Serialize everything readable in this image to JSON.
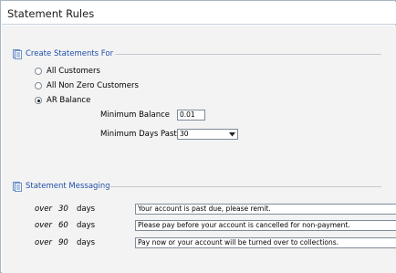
{
  "header": {
    "title": "Statement Rules"
  },
  "create_section": {
    "title": "Create Statements For",
    "icon": "document-icon",
    "options": [
      {
        "label": "All Customers",
        "selected": false
      },
      {
        "label": "All Non Zero Customers",
        "selected": false
      },
      {
        "label": "AR Balance",
        "selected": true
      }
    ],
    "minimum_balance": {
      "label": "Minimum Balance",
      "value": "0.01"
    },
    "minimum_days_past": {
      "label": "Minimum Days Past",
      "value": "30"
    }
  },
  "messaging_section": {
    "title": "Statement Messaging",
    "icon": "document-icon",
    "rows": [
      {
        "over": "over",
        "days_number": "30",
        "days_label": "days",
        "message": "Your account is past due, please remit."
      },
      {
        "over": "over",
        "days_number": "60",
        "days_label": "days",
        "message": "Please pay before your account is cancelled for non-payment."
      },
      {
        "over": "over",
        "days_number": "90",
        "days_label": "days",
        "message": "Pay now or your account will be turned over to collections."
      }
    ]
  },
  "colors": {
    "section_title": "#1f4fa8",
    "panel_bg": "#f3f3f3",
    "border": "#a9b4c2"
  }
}
